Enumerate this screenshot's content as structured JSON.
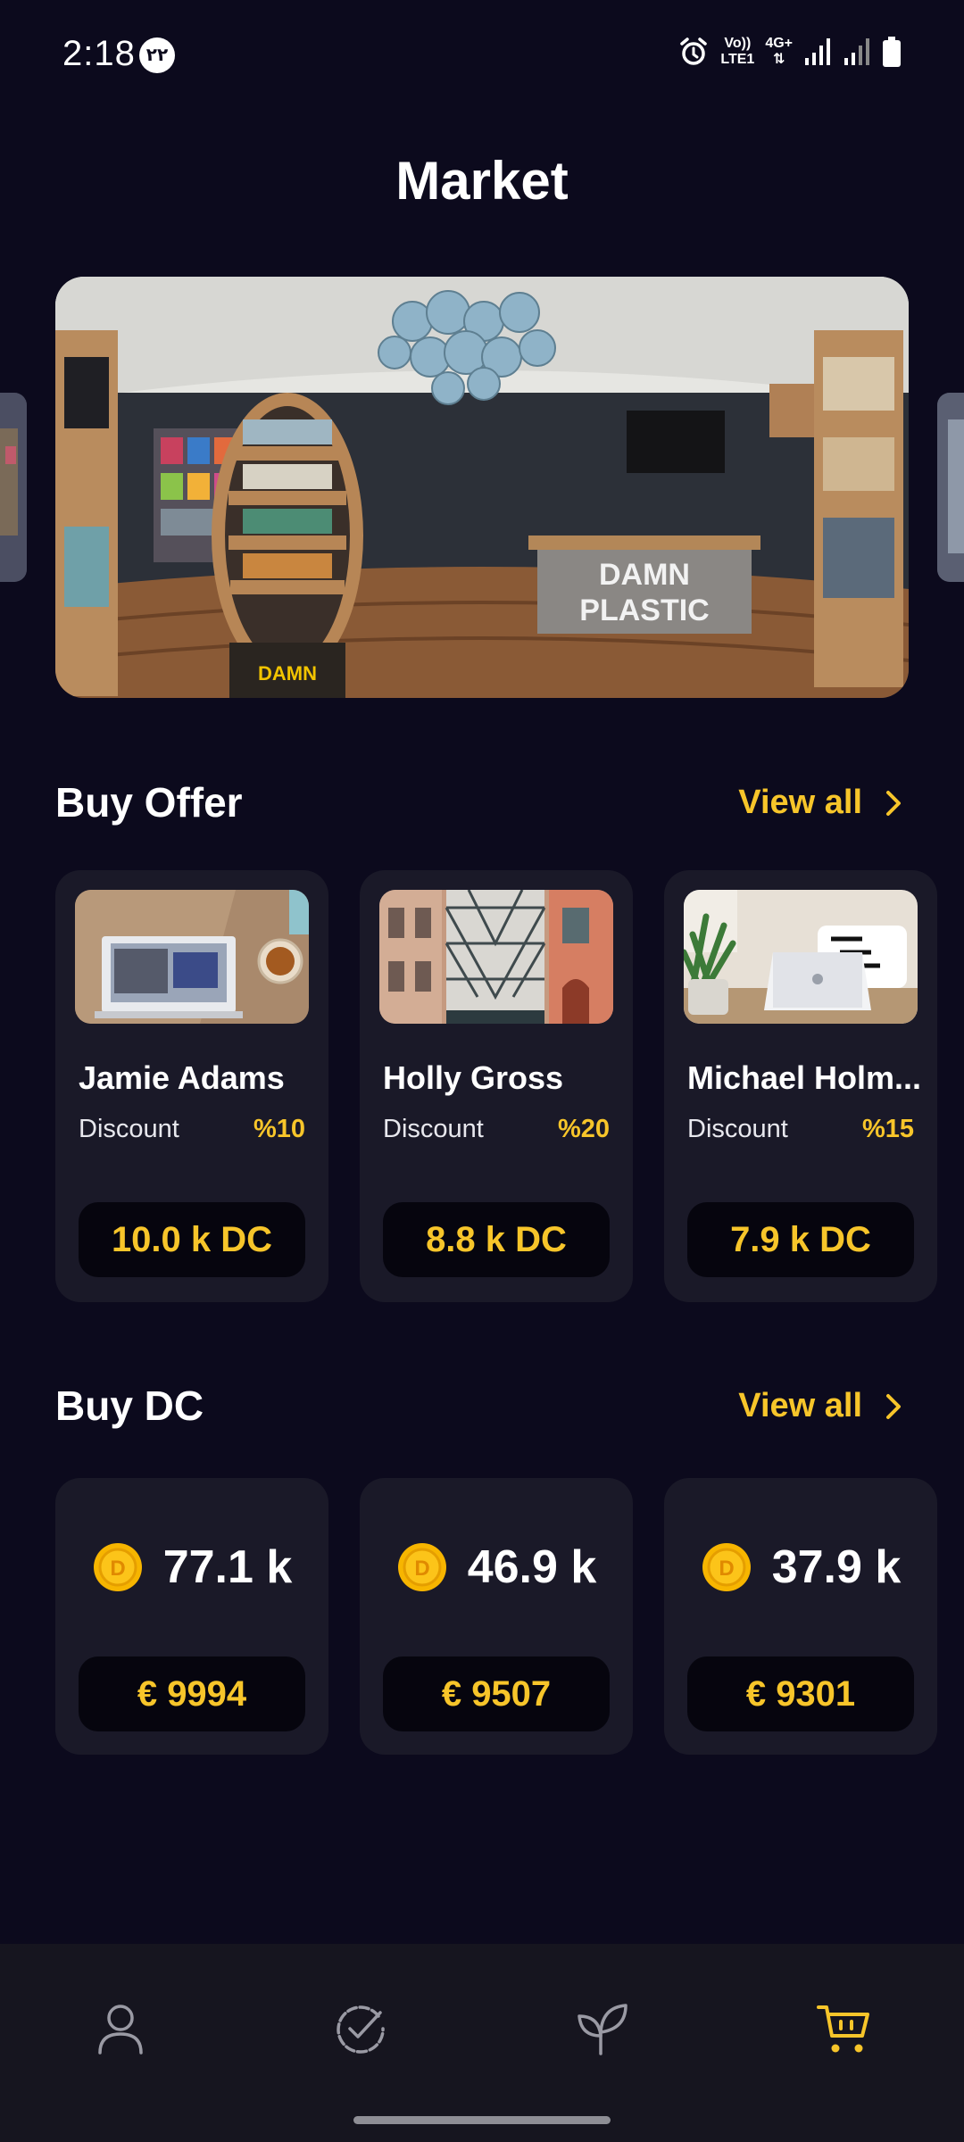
{
  "status_bar": {
    "time": "2:18",
    "badge": "۲۲",
    "volte_top": "Vo))",
    "volte_bottom": "LTE1",
    "network": "4G+"
  },
  "page": {
    "title": "Market"
  },
  "sections": {
    "buy_offer": {
      "title": "Buy Offer",
      "view_all": "View all"
    },
    "buy_dc": {
      "title": "Buy DC",
      "view_all": "View all"
    }
  },
  "offers": [
    {
      "name": "Jamie Adams",
      "discount_label": "Discount",
      "discount": "%10",
      "price": "10.0 k DC"
    },
    {
      "name": "Holly Gross",
      "discount_label": "Discount",
      "discount": "%20",
      "price": "8.8 k DC"
    },
    {
      "name": "Michael Holm...",
      "discount_label": "Discount",
      "discount": "%15",
      "price": "7.9 k DC"
    }
  ],
  "dc_packages": [
    {
      "amount": "77.1 k",
      "price": "€ 9994"
    },
    {
      "amount": "46.9 k",
      "price": "€ 9507"
    },
    {
      "amount": "37.9 k",
      "price": "€ 9301"
    }
  ],
  "colors": {
    "background": "#0c0a1d",
    "card": "#1a1928",
    "accent": "#f7c52a",
    "nav_background": "#16151f"
  },
  "icons": {
    "nav": [
      "profile-icon",
      "task-check-icon",
      "plant-icon",
      "cart-icon"
    ],
    "active_nav": "cart-icon"
  }
}
